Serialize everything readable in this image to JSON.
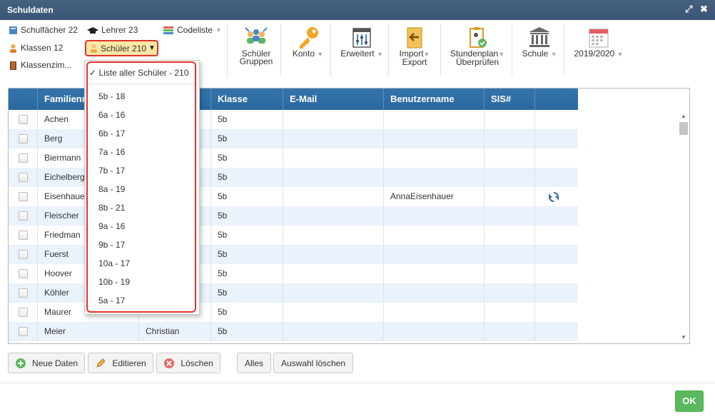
{
  "window": {
    "title": "Schuldaten",
    "expand_icon": "⤢",
    "close_icon": "✖"
  },
  "toolbar": {
    "faecher": "Schulfächer 22",
    "lehrer": "Lehrer 23",
    "codeliste": "Codeliste",
    "klassen": "Klassen 12",
    "schueler": "Schüler 210",
    "klassenzimmer": "Klassenzim...",
    "groups": [
      "Schüler",
      "Gruppen"
    ],
    "konto": "Konto",
    "erweitert": "Erweitert",
    "import": [
      "Import",
      "Export"
    ],
    "stundenplan": [
      "Stundenplan",
      "Überprüfen"
    ],
    "schule": "Schule",
    "year": "2019/2020"
  },
  "dropdown": {
    "selected": "✓ Liste aller Schüler - 210",
    "items": [
      "5b - 18",
      "6a - 16",
      "6b - 17",
      "7a - 16",
      "7b - 17",
      "8a - 19",
      "8b - 21",
      "9a - 16",
      "9b - 17",
      "10a - 17",
      "10b - 19",
      "5a - 17"
    ]
  },
  "table": {
    "headers": [
      "Familienn",
      "",
      "Klasse",
      "E-Mail",
      "Benutzername",
      "SIS#"
    ],
    "rows": [
      {
        "last": "Achen",
        "first": "",
        "klasse": "5b",
        "email": "",
        "user": "",
        "sis": ""
      },
      {
        "last": "Berg",
        "first": "",
        "klasse": "5b",
        "email": "",
        "user": "",
        "sis": ""
      },
      {
        "last": "Biermann",
        "first": "",
        "klasse": "5b",
        "email": "",
        "user": "",
        "sis": ""
      },
      {
        "last": "Eichelberg",
        "first": "",
        "klasse": "5b",
        "email": "",
        "user": "",
        "sis": ""
      },
      {
        "last": "Eisenhaue",
        "first": "",
        "klasse": "5b",
        "email": "",
        "user": "AnnaEisenhauer",
        "sis": ""
      },
      {
        "last": "Fleischer",
        "first": "",
        "klasse": "5b",
        "email": "",
        "user": "",
        "sis": ""
      },
      {
        "last": "Friedman",
        "first": "",
        "klasse": "5b",
        "email": "",
        "user": "",
        "sis": ""
      },
      {
        "last": "Fuerst",
        "first": "",
        "klasse": "5b",
        "email": "",
        "user": "",
        "sis": ""
      },
      {
        "last": "Hoover",
        "first": "",
        "klasse": "5b",
        "email": "",
        "user": "",
        "sis": ""
      },
      {
        "last": "Köhler",
        "first": "",
        "klasse": "5b",
        "email": "",
        "user": "",
        "sis": ""
      },
      {
        "last": "Maurer",
        "first": "",
        "klasse": "5b",
        "email": "",
        "user": "",
        "sis": ""
      },
      {
        "last": "Meier",
        "first": "Christian",
        "klasse": "5b",
        "email": "",
        "user": "",
        "sis": ""
      }
    ]
  },
  "buttons": {
    "neu": "Neue Daten",
    "edit": "Editieren",
    "del": "Löschen",
    "alles": "Alles",
    "clear": "Auswahl löschen",
    "ok": "OK"
  },
  "colors": {
    "header_blue": "#2e6da4",
    "row_alt": "#eaf2fb",
    "ok_green": "#5cb85c",
    "highlight_red": "#e0322b"
  }
}
